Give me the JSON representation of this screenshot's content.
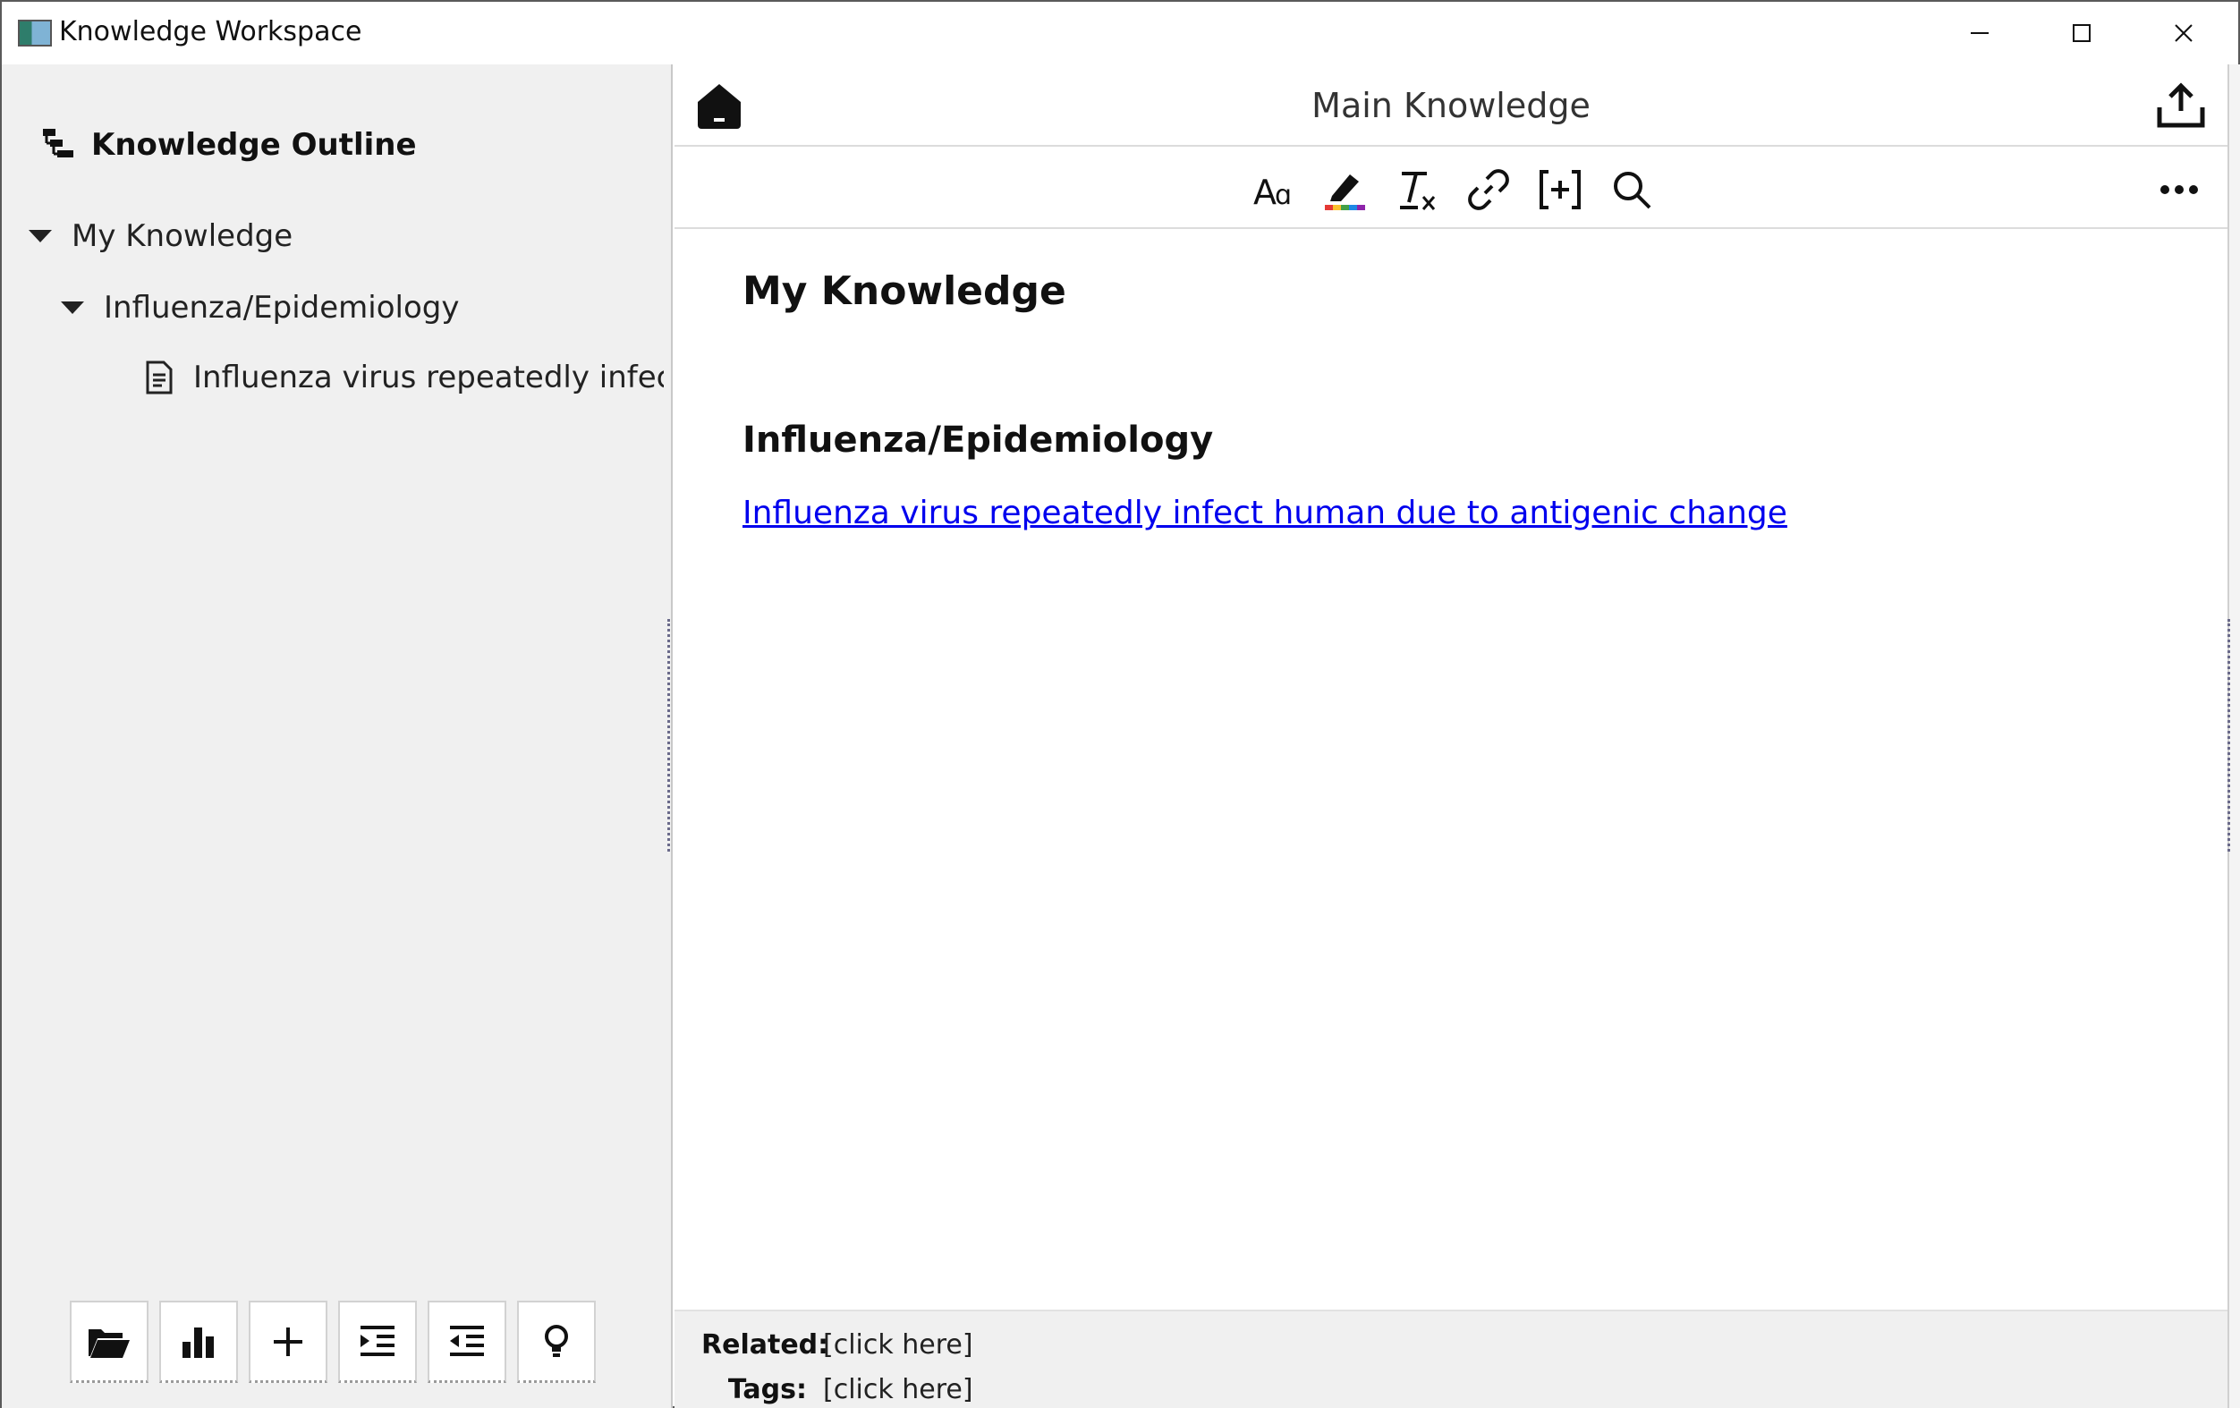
{
  "window": {
    "title": "Knowledge Workspace",
    "controls": [
      "minimize-icon",
      "maximize-icon",
      "close-icon"
    ]
  },
  "sidebar": {
    "header": "Knowledge Outline",
    "tree": [
      {
        "label": "My Knowledge",
        "expanded": true,
        "level": 0
      },
      {
        "label": "Influenza/Epidemiology",
        "expanded": true,
        "level": 1
      },
      {
        "label": "Influenza virus repeatedly infect human due to antigenic change",
        "level": 2,
        "icon": "document-icon"
      }
    ],
    "tools": [
      "folder-open-icon",
      "bar-chart-icon",
      "plus-icon",
      "indent-icon",
      "outdent-icon",
      "lightbulb-icon"
    ]
  },
  "editor": {
    "title": "Main Knowledge",
    "toolbar": [
      "font-icon",
      "highlighter-icon",
      "clear-format-icon",
      "link-icon",
      "insert-bracket-icon",
      "search-icon"
    ],
    "heading": "My Knowledge",
    "subheading": "Influenza/Epidemiology",
    "link_text": "Influenza virus repeatedly infect human due to antigenic change"
  },
  "footer": {
    "related_label": "Related:",
    "related_value": "[click here]",
    "tags_label": "Tags:",
    "tags_value": "[click here]"
  },
  "colors": {
    "panel_bg": "#f0f0f0",
    "link": "#0000ee",
    "highlighter_stripe": [
      "#e53935",
      "#fbc02d",
      "#43a047",
      "#1e88e5",
      "#8e24aa"
    ]
  }
}
